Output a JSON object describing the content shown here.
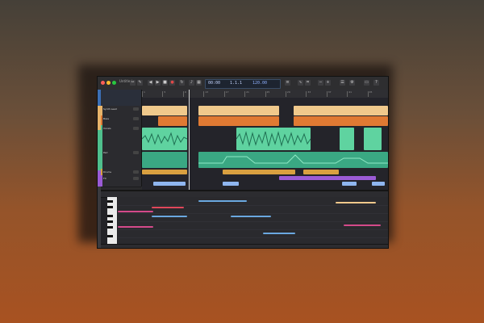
{
  "window": {
    "title": "Untitled",
    "accent": "#4f7bd6"
  },
  "toolbar": {
    "icons": [
      "scissors-icon",
      "pencil-icon",
      "play-icon",
      "stop-icon",
      "record-icon",
      "loop-icon",
      "metronome-icon",
      "mixer-icon",
      "settings-icon"
    ]
  },
  "transport": {
    "time": "00:00",
    "bars": "1.1.1",
    "tempo": "120.00"
  },
  "ruler": {
    "labels": [
      "1",
      "5",
      "9",
      "13",
      "17",
      "21",
      "25",
      "29",
      "33",
      "37",
      "41",
      "45"
    ]
  },
  "tracks": [
    {
      "name": "Synth Lead",
      "color": "#e8b46a"
    },
    {
      "name": "Bass",
      "color": "#e07a33"
    },
    {
      "name": "Vocals",
      "color": "#4fc08d"
    },
    {
      "name": "Pad",
      "color": "#4fc08d"
    },
    {
      "name": "Drums",
      "color": "#d9a040"
    },
    {
      "name": "FX",
      "color": "#9b5bd6"
    }
  ],
  "colors": {
    "clip_peach": "#f0c98c",
    "clip_orange": "#e07a33",
    "clip_green": "#5fd3a0",
    "clip_teal": "#3aa883",
    "clip_gold": "#d9a040",
    "clip_purple": "#9b5bd6",
    "clip_blue": "#8fb6f0",
    "note_pink": "#d44a8a",
    "note_red": "#e0475a",
    "note_blue": "#6aa8e0",
    "note_peach": "#f0c98c"
  }
}
